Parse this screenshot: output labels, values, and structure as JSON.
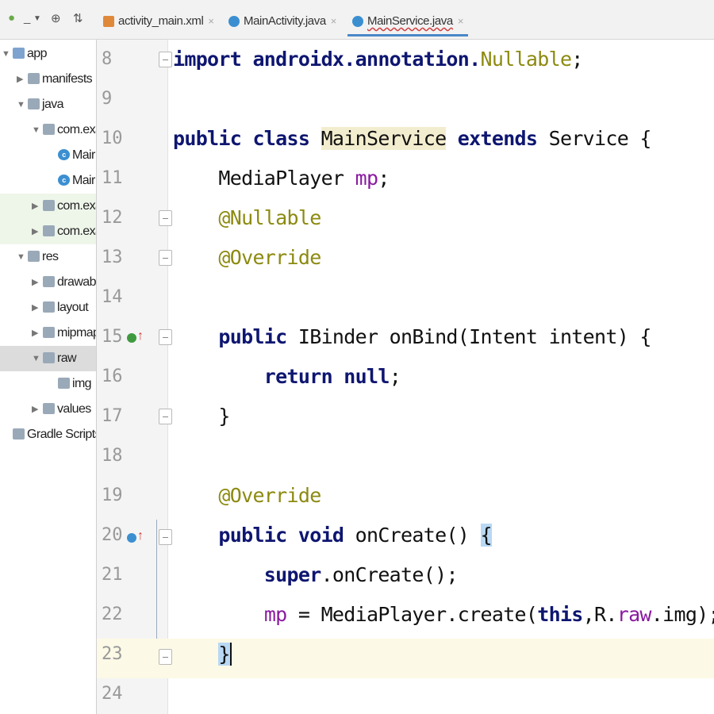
{
  "project_toolbar": {
    "android_icon": "android-icon",
    "view_label": "_",
    "dropdown_icon": "chevron-down-icon",
    "target_icon": "crosshair-icon",
    "collapse_icon": "collapse-icon"
  },
  "tree": [
    {
      "label": "app",
      "icon": "module-icon",
      "indent": 0,
      "expanded": true
    },
    {
      "label": "manifests",
      "icon": "folder-icon",
      "indent": 1,
      "expanded": false
    },
    {
      "label": "java",
      "icon": "folder-icon",
      "indent": 1,
      "expanded": true
    },
    {
      "label": "com.exa",
      "icon": "package-icon",
      "indent": 2,
      "expanded": true
    },
    {
      "label": "Mair",
      "icon": "class-icon",
      "indent": 3
    },
    {
      "label": "Mair",
      "icon": "class-icon",
      "indent": 3
    },
    {
      "label": "com.exa",
      "icon": "package-icon",
      "indent": 2,
      "expanded": false
    },
    {
      "label": "com.exa",
      "icon": "package-icon",
      "indent": 2,
      "expanded": false
    },
    {
      "label": "res",
      "icon": "res-folder-icon",
      "indent": 1,
      "expanded": true
    },
    {
      "label": "drawabl",
      "icon": "folder-icon",
      "indent": 2,
      "expanded": false
    },
    {
      "label": "layout",
      "icon": "folder-icon",
      "indent": 2,
      "expanded": false
    },
    {
      "label": "mipmap",
      "icon": "folder-icon",
      "indent": 2,
      "expanded": false
    },
    {
      "label": "raw",
      "icon": "folder-icon",
      "indent": 2,
      "expanded": true
    },
    {
      "label": "img",
      "icon": "file-icon",
      "indent": 3
    },
    {
      "label": "values",
      "icon": "folder-icon",
      "indent": 2,
      "expanded": false
    },
    {
      "label": "Gradle Scripts",
      "icon": "gradle-icon",
      "indent": 0
    }
  ],
  "tabs": [
    {
      "label": "activity_main.xml",
      "icon": "xml-file-icon",
      "close": "×"
    },
    {
      "label": "MainActivity.java",
      "icon": "class-icon",
      "close": "×"
    },
    {
      "label": "MainService.java",
      "icon": "class-icon",
      "close": "×",
      "active": true
    }
  ],
  "line_numbers": [
    "8",
    "9",
    "10",
    "11",
    "12",
    "13",
    "14",
    "15",
    "16",
    "17",
    "18",
    "19",
    "20",
    "21",
    "22",
    "23",
    "24"
  ],
  "code": {
    "l8": {
      "a": "import androidx.annotation.",
      "b": "Nullable",
      "c": ";"
    },
    "l10": {
      "kw1": "public class ",
      "cls": "MainService",
      "kw2": " extends",
      "rest": " Service {"
    },
    "l11": {
      "a": "    MediaPlayer ",
      "f": "mp",
      "c": ";"
    },
    "l12": {
      "ann": "    @Nullable"
    },
    "l13": {
      "ann": "    @Override"
    },
    "l15": {
      "kw": "    public",
      "rest": " IBinder onBind(Intent intent) {"
    },
    "l16": {
      "kw1": "        return",
      "sp": " ",
      "kw2": "null",
      "c": ";"
    },
    "l17": {
      "a": "    }"
    },
    "l19": {
      "ann": "    @Override"
    },
    "l20": {
      "kw": "    public void",
      "rest": " onCreate() ",
      "brace": "{"
    },
    "l21": {
      "kw": "        super",
      "rest": ".onCreate();"
    },
    "l22": {
      "pad": "        ",
      "f1": "mp",
      "a": " = MediaPlayer.create(",
      "kw": "this",
      "b": ",R.",
      "f2": "raw",
      "c": ".img);"
    },
    "l23": {
      "pad": "    ",
      "brace": "}"
    }
  },
  "colors": {
    "keyword": "#0e1670",
    "annotation": "#8c8a10",
    "field": "#8a1aa0",
    "current_line": "#fcf9e6",
    "tab_active": "#4a88c7"
  }
}
